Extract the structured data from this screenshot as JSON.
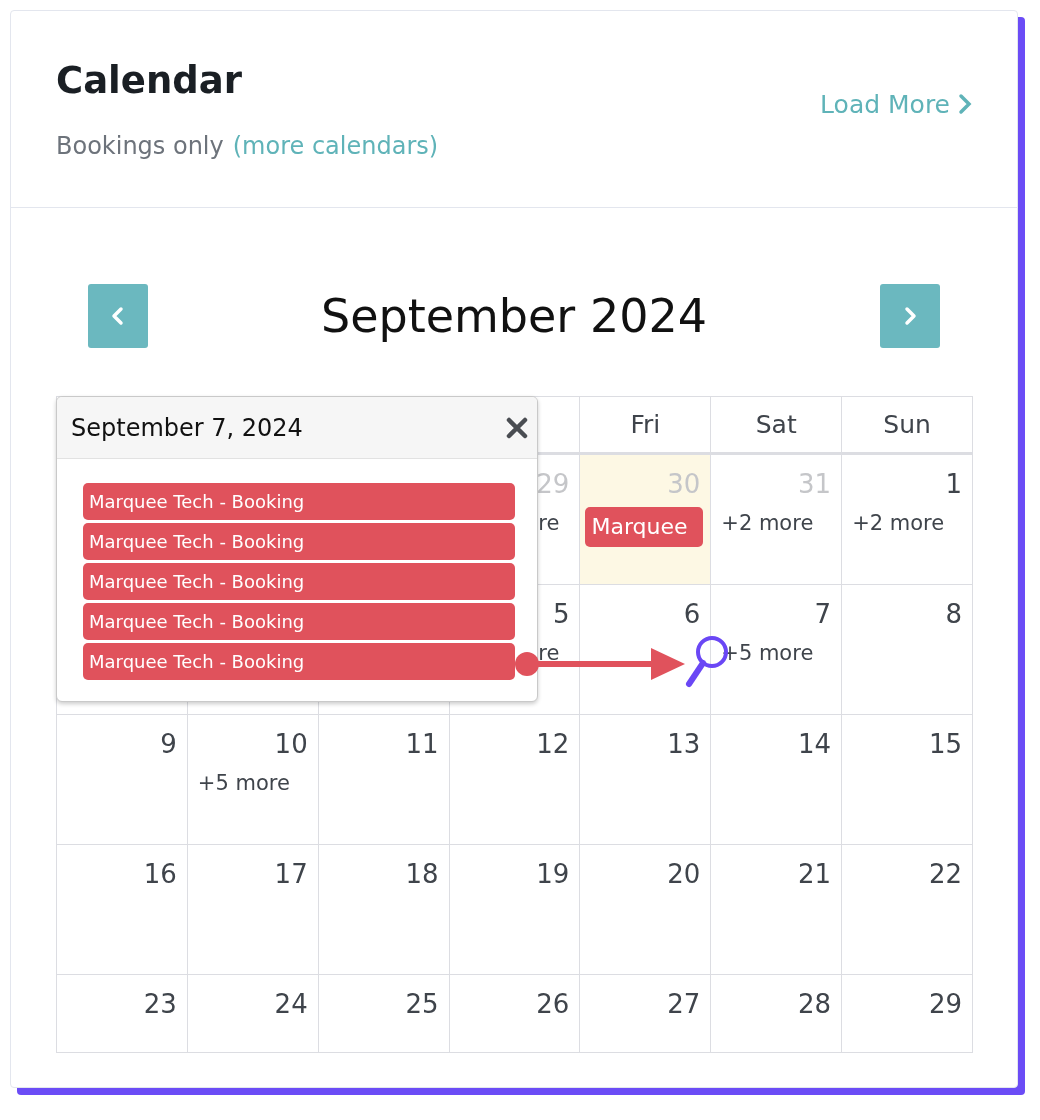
{
  "card": {
    "title": "Calendar",
    "subtitle": "Bookings only",
    "subtitle_link": "(more calendars)",
    "load_more": "Load More"
  },
  "calendar": {
    "month": "September 2024",
    "weekdays": [
      "Fri",
      "Sat",
      "Sun"
    ],
    "weeks": [
      {
        "cells": [
          {
            "day": "29",
            "outside": true,
            "today": false,
            "more": "re",
            "clipped": true
          },
          {
            "day": "30",
            "outside": true,
            "today": true,
            "events": [
              "Marquee"
            ]
          },
          {
            "day": "31",
            "outside": true,
            "today": false,
            "more": "+2 more"
          },
          {
            "day": "1",
            "outside": false,
            "today": false,
            "more": "+2 more"
          }
        ]
      },
      {
        "cells": [
          {
            "day": "5",
            "outside": false,
            "today": false,
            "more": "re",
            "clipped": true
          },
          {
            "day": "6",
            "outside": false,
            "today": false
          },
          {
            "day": "7",
            "outside": false,
            "today": false,
            "more": "+5 more"
          },
          {
            "day": "8",
            "outside": false,
            "today": false
          }
        ]
      },
      {
        "cells": [
          {
            "day": "9",
            "outside": false,
            "today": false
          },
          {
            "day": "10",
            "outside": false,
            "today": false,
            "more": "+5 more"
          },
          {
            "day": "11",
            "outside": false,
            "today": false
          },
          {
            "day": "12",
            "outside": false,
            "today": false
          },
          {
            "day": "13",
            "outside": false,
            "today": false
          },
          {
            "day": "14",
            "outside": false,
            "today": false
          },
          {
            "day": "15",
            "outside": false,
            "today": false
          }
        ]
      },
      {
        "cells": [
          {
            "day": "16",
            "outside": false,
            "today": false
          },
          {
            "day": "17",
            "outside": false,
            "today": false
          },
          {
            "day": "18",
            "outside": false,
            "today": false
          },
          {
            "day": "19",
            "outside": false,
            "today": false
          },
          {
            "day": "20",
            "outside": false,
            "today": false
          },
          {
            "day": "21",
            "outside": false,
            "today": false
          },
          {
            "day": "22",
            "outside": false,
            "today": false
          }
        ]
      },
      {
        "cells": [
          {
            "day": "23",
            "outside": false,
            "today": false
          },
          {
            "day": "24",
            "outside": false,
            "today": false
          },
          {
            "day": "25",
            "outside": false,
            "today": false
          },
          {
            "day": "26",
            "outside": false,
            "today": false
          },
          {
            "day": "27",
            "outside": false,
            "today": false
          },
          {
            "day": "28",
            "outside": false,
            "today": false
          },
          {
            "day": "29",
            "outside": false,
            "today": false
          }
        ]
      }
    ]
  },
  "popover": {
    "title": "September 7, 2024",
    "events": [
      "Marquee Tech - Booking",
      "Marquee Tech - Booking",
      "Marquee Tech - Booking",
      "Marquee Tech - Booking",
      "Marquee Tech - Booking"
    ]
  }
}
